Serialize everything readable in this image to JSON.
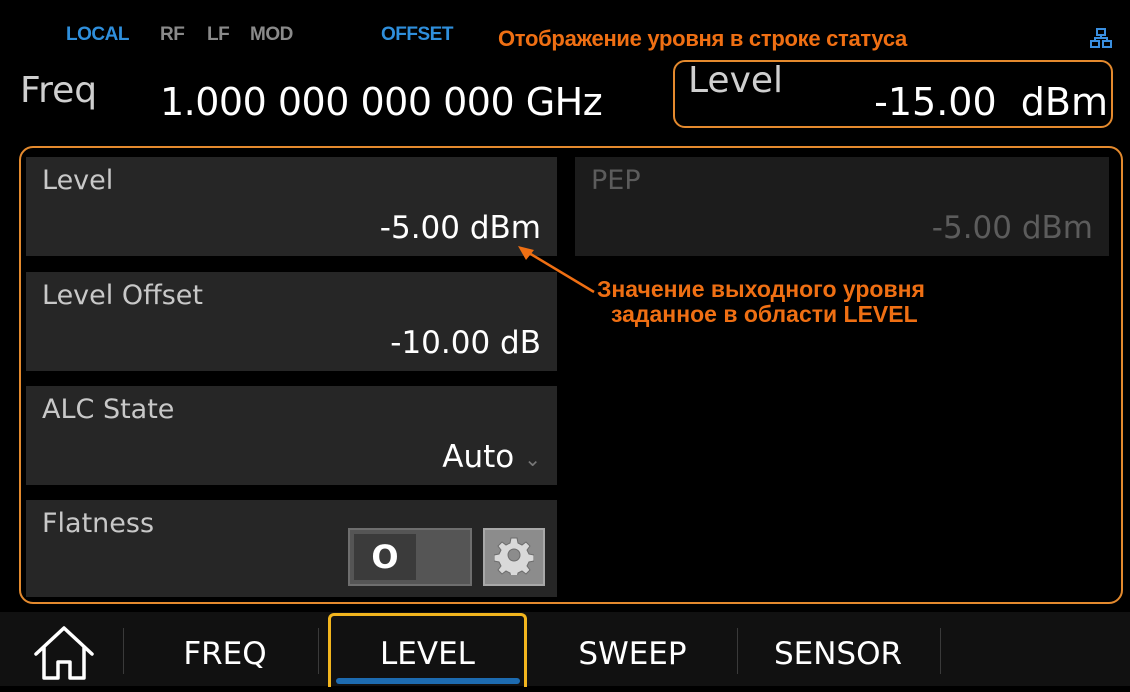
{
  "status": {
    "local": "LOCAL",
    "rf": "RF",
    "lf": "LF",
    "mod": "MOD",
    "offset": "OFFSET",
    "annotation": "Отображение уровня в строке статуса"
  },
  "header": {
    "freq_label": "Freq",
    "freq_value": "1.000 000 000 000 GHz",
    "level_label": "Level",
    "level_value": "-15.00  dBm"
  },
  "fields": {
    "level": {
      "label": "Level",
      "value": "-5.00 dBm"
    },
    "level_offset": {
      "label": "Level Offset",
      "value": "-10.00 dB"
    },
    "alc_state": {
      "label": "ALC State",
      "value": "Auto"
    },
    "flatness": {
      "label": "Flatness",
      "toggle": "O"
    },
    "pep": {
      "label": "PEP",
      "value": "-5.00 dBm"
    }
  },
  "annotation_main": {
    "line1": "Значение выходного уровня",
    "line2": "заданное в области LEVEL"
  },
  "tabs": [
    {
      "label": "FREQ"
    },
    {
      "label": "LEVEL"
    },
    {
      "label": "SWEEP"
    },
    {
      "label": "SENSOR"
    }
  ],
  "active_tab": "LEVEL",
  "colors": {
    "annotation": "#ef6f13",
    "highlight_border": "#e48a2e",
    "status_blue": "#2f8fdc",
    "tab_active_border": "#f2b51e"
  },
  "icons": {
    "network": "network-icon",
    "home": "home-icon",
    "gear": "gear-icon",
    "chevron": "chevron-down-icon"
  }
}
